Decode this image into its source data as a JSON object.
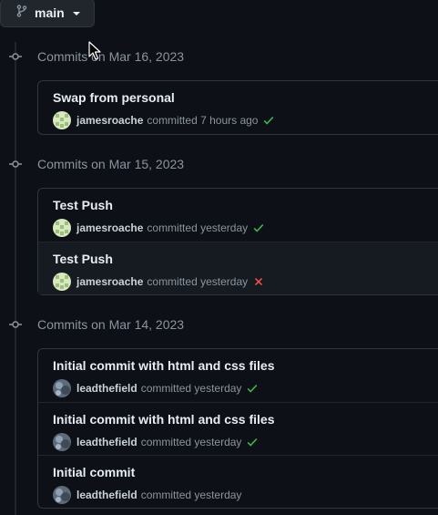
{
  "branch": {
    "name": "main"
  },
  "groups": [
    {
      "title": "Commits on Mar 16, 2023",
      "commits": [
        {
          "message": "Swap from personal",
          "author": "jamesroache",
          "action": "committed",
          "time": "7 hours ago",
          "status": "success"
        }
      ]
    },
    {
      "title": "Commits on Mar 15, 2023",
      "commits": [
        {
          "message": "Test Push",
          "author": "jamesroache",
          "action": "committed",
          "time": "yesterday",
          "status": "success"
        },
        {
          "message": "Test Push",
          "author": "jamesroache",
          "action": "committed",
          "time": "yesterday",
          "status": "failure"
        }
      ]
    },
    {
      "title": "Commits on Mar 14, 2023",
      "commits": [
        {
          "message": "Initial commit with html and css files",
          "author": "leadthefield",
          "action": "committed",
          "time": "yesterday",
          "status": "success"
        },
        {
          "message": "Initial commit with html and css files",
          "author": "leadthefield",
          "action": "committed",
          "time": "yesterday",
          "status": "success"
        },
        {
          "message": "Initial commit",
          "author": "leadthefield",
          "action": "committed",
          "time": "yesterday",
          "status": "none"
        }
      ]
    }
  ],
  "colors": {
    "success": "#3fb950",
    "failure": "#f85149",
    "background": "#0d1117",
    "border": "#30363d"
  }
}
